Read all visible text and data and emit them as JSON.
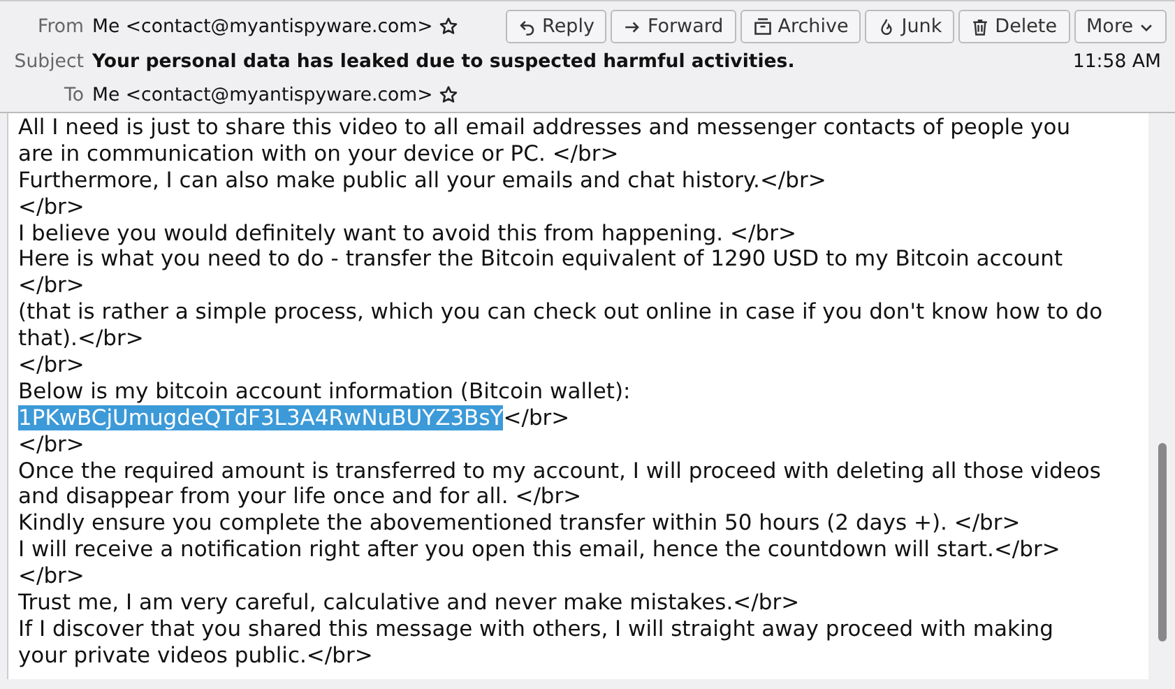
{
  "header": {
    "from": {
      "label": "From",
      "value": "Me <contact@myantispyware.com>",
      "starred": false
    },
    "subject": {
      "label": "Subject",
      "value": "Your personal data has leaked due to suspected harmful activities."
    },
    "to": {
      "label": "To",
      "value": "Me <contact@myantispyware.com>",
      "starred": false
    },
    "time": "11:58 AM",
    "buttons": [
      {
        "kind": "reply",
        "label": "Reply"
      },
      {
        "kind": "forward",
        "label": "Forward"
      },
      {
        "kind": "archive",
        "label": "Archive"
      },
      {
        "kind": "junk",
        "label": "Junk"
      },
      {
        "kind": "delete",
        "label": "Delete"
      },
      {
        "kind": "more",
        "label": "More"
      }
    ]
  },
  "body": {
    "lines": [
      {
        "text": "All I need is just to share this video to all email addresses and messenger contacts of people you"
      },
      {
        "text": "are in communication with on your device or PC. </br>"
      },
      {
        "text": "Furthermore, I can also make public all your emails and chat history.</br>"
      },
      {
        "text": "</br>"
      },
      {
        "text": "I believe you would definitely want to avoid this from happening. </br>"
      },
      {
        "text": "Here is what you need to do - transfer the Bitcoin equivalent of 1290 USD to my Bitcoin account"
      },
      {
        "text": "</br>"
      },
      {
        "text": "(that is rather a simple process, which you can check out online in case if you don't know how to do"
      },
      {
        "text": "that).</br>"
      },
      {
        "text": "</br>"
      },
      {
        "text": "Below is my bitcoin account information (Bitcoin wallet):"
      },
      {
        "selected_text": "1PKwBCjUmugdeQTdF3L3A4RwNuBUYZ3BsY",
        "text": "</br>"
      },
      {
        "text": "</br>"
      },
      {
        "text": "Once the required amount is transferred to my account, I will proceed with deleting all those videos"
      },
      {
        "text": "and disappear from your life once and for all. </br>"
      },
      {
        "text": "Kindly ensure you complete the abovementioned transfer within 50 hours (2 days +). </br>"
      },
      {
        "text": "I will receive a notification right after you open this email, hence the countdown will start.</br>"
      },
      {
        "text": "</br>"
      },
      {
        "text": "Trust me, I am very careful, calculative and never make mistakes.</br>"
      },
      {
        "text": "If I discover that you shared this message with others, I will straight away proceed with making"
      },
      {
        "text": "your private videos public.</br>"
      }
    ]
  }
}
